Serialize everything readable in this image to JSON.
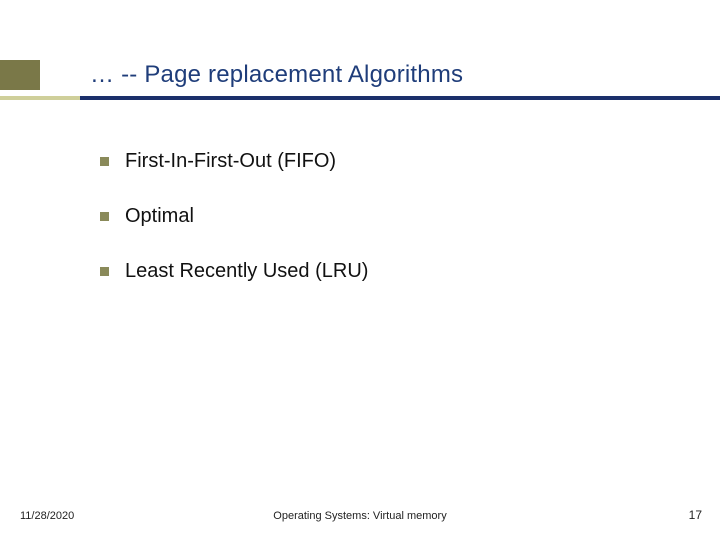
{
  "title": "… -- Page replacement Algorithms",
  "bullets": [
    "First-In-First-Out (FIFO)",
    "Optimal",
    "Least Recently Used (LRU)"
  ],
  "footer": {
    "date": "11/28/2020",
    "center": "Operating Systems: Virtual memory",
    "page": "17"
  }
}
